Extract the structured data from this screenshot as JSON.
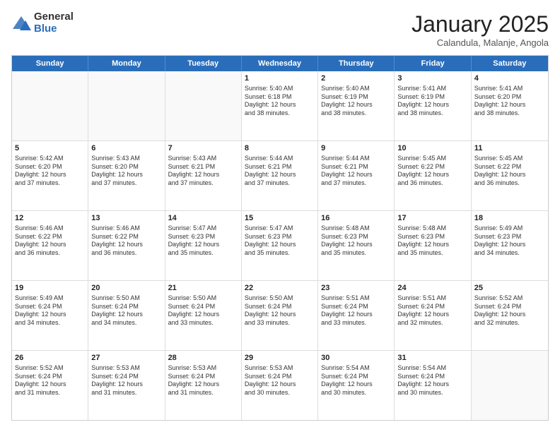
{
  "logo": {
    "general": "General",
    "blue": "Blue"
  },
  "title": {
    "month": "January 2025",
    "location": "Calandula, Malanje, Angola"
  },
  "header_days": [
    "Sunday",
    "Monday",
    "Tuesday",
    "Wednesday",
    "Thursday",
    "Friday",
    "Saturday"
  ],
  "weeks": [
    [
      {
        "day": "",
        "text": "",
        "empty": true
      },
      {
        "day": "",
        "text": "",
        "empty": true
      },
      {
        "day": "",
        "text": "",
        "empty": true
      },
      {
        "day": "1",
        "text": "Sunrise: 5:40 AM\nSunset: 6:18 PM\nDaylight: 12 hours\nand 38 minutes."
      },
      {
        "day": "2",
        "text": "Sunrise: 5:40 AM\nSunset: 6:19 PM\nDaylight: 12 hours\nand 38 minutes."
      },
      {
        "day": "3",
        "text": "Sunrise: 5:41 AM\nSunset: 6:19 PM\nDaylight: 12 hours\nand 38 minutes."
      },
      {
        "day": "4",
        "text": "Sunrise: 5:41 AM\nSunset: 6:20 PM\nDaylight: 12 hours\nand 38 minutes."
      }
    ],
    [
      {
        "day": "5",
        "text": "Sunrise: 5:42 AM\nSunset: 6:20 PM\nDaylight: 12 hours\nand 37 minutes."
      },
      {
        "day": "6",
        "text": "Sunrise: 5:43 AM\nSunset: 6:20 PM\nDaylight: 12 hours\nand 37 minutes."
      },
      {
        "day": "7",
        "text": "Sunrise: 5:43 AM\nSunset: 6:21 PM\nDaylight: 12 hours\nand 37 minutes."
      },
      {
        "day": "8",
        "text": "Sunrise: 5:44 AM\nSunset: 6:21 PM\nDaylight: 12 hours\nand 37 minutes."
      },
      {
        "day": "9",
        "text": "Sunrise: 5:44 AM\nSunset: 6:21 PM\nDaylight: 12 hours\nand 37 minutes."
      },
      {
        "day": "10",
        "text": "Sunrise: 5:45 AM\nSunset: 6:22 PM\nDaylight: 12 hours\nand 36 minutes."
      },
      {
        "day": "11",
        "text": "Sunrise: 5:45 AM\nSunset: 6:22 PM\nDaylight: 12 hours\nand 36 minutes."
      }
    ],
    [
      {
        "day": "12",
        "text": "Sunrise: 5:46 AM\nSunset: 6:22 PM\nDaylight: 12 hours\nand 36 minutes."
      },
      {
        "day": "13",
        "text": "Sunrise: 5:46 AM\nSunset: 6:22 PM\nDaylight: 12 hours\nand 36 minutes."
      },
      {
        "day": "14",
        "text": "Sunrise: 5:47 AM\nSunset: 6:23 PM\nDaylight: 12 hours\nand 35 minutes."
      },
      {
        "day": "15",
        "text": "Sunrise: 5:47 AM\nSunset: 6:23 PM\nDaylight: 12 hours\nand 35 minutes."
      },
      {
        "day": "16",
        "text": "Sunrise: 5:48 AM\nSunset: 6:23 PM\nDaylight: 12 hours\nand 35 minutes."
      },
      {
        "day": "17",
        "text": "Sunrise: 5:48 AM\nSunset: 6:23 PM\nDaylight: 12 hours\nand 35 minutes."
      },
      {
        "day": "18",
        "text": "Sunrise: 5:49 AM\nSunset: 6:23 PM\nDaylight: 12 hours\nand 34 minutes."
      }
    ],
    [
      {
        "day": "19",
        "text": "Sunrise: 5:49 AM\nSunset: 6:24 PM\nDaylight: 12 hours\nand 34 minutes."
      },
      {
        "day": "20",
        "text": "Sunrise: 5:50 AM\nSunset: 6:24 PM\nDaylight: 12 hours\nand 34 minutes."
      },
      {
        "day": "21",
        "text": "Sunrise: 5:50 AM\nSunset: 6:24 PM\nDaylight: 12 hours\nand 33 minutes."
      },
      {
        "day": "22",
        "text": "Sunrise: 5:50 AM\nSunset: 6:24 PM\nDaylight: 12 hours\nand 33 minutes."
      },
      {
        "day": "23",
        "text": "Sunrise: 5:51 AM\nSunset: 6:24 PM\nDaylight: 12 hours\nand 33 minutes."
      },
      {
        "day": "24",
        "text": "Sunrise: 5:51 AM\nSunset: 6:24 PM\nDaylight: 12 hours\nand 32 minutes."
      },
      {
        "day": "25",
        "text": "Sunrise: 5:52 AM\nSunset: 6:24 PM\nDaylight: 12 hours\nand 32 minutes."
      }
    ],
    [
      {
        "day": "26",
        "text": "Sunrise: 5:52 AM\nSunset: 6:24 PM\nDaylight: 12 hours\nand 31 minutes."
      },
      {
        "day": "27",
        "text": "Sunrise: 5:53 AM\nSunset: 6:24 PM\nDaylight: 12 hours\nand 31 minutes."
      },
      {
        "day": "28",
        "text": "Sunrise: 5:53 AM\nSunset: 6:24 PM\nDaylight: 12 hours\nand 31 minutes."
      },
      {
        "day": "29",
        "text": "Sunrise: 5:53 AM\nSunset: 6:24 PM\nDaylight: 12 hours\nand 30 minutes."
      },
      {
        "day": "30",
        "text": "Sunrise: 5:54 AM\nSunset: 6:24 PM\nDaylight: 12 hours\nand 30 minutes."
      },
      {
        "day": "31",
        "text": "Sunrise: 5:54 AM\nSunset: 6:24 PM\nDaylight: 12 hours\nand 30 minutes."
      },
      {
        "day": "",
        "text": "",
        "empty": true
      }
    ]
  ]
}
